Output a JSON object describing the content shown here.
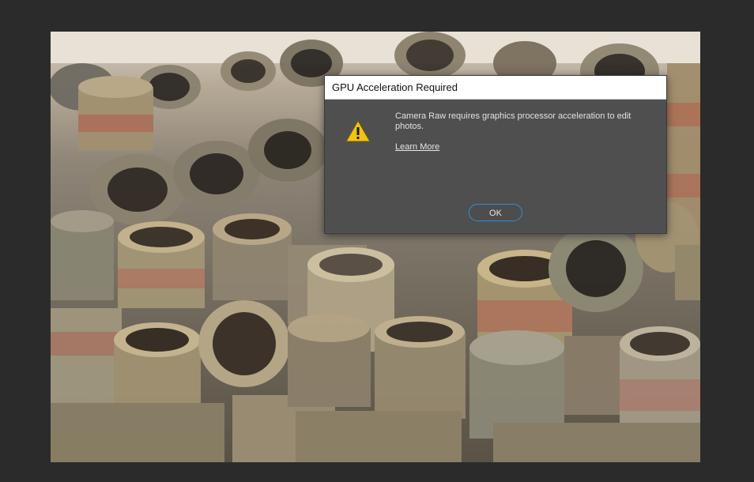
{
  "dialog": {
    "title": "GPU Acceleration Required",
    "message": "Camera Raw requires graphics processor acceleration to edit photos.",
    "learn_more": "Learn More",
    "ok_label": "OK",
    "icon": "warning-icon"
  },
  "colors": {
    "workspace_bg": "#2b2b2b",
    "dialog_bg": "#4f4f4f",
    "titlebar_bg": "#ffffff",
    "ok_border": "#2f8fd6",
    "warning_yellow": "#f2c40f"
  }
}
